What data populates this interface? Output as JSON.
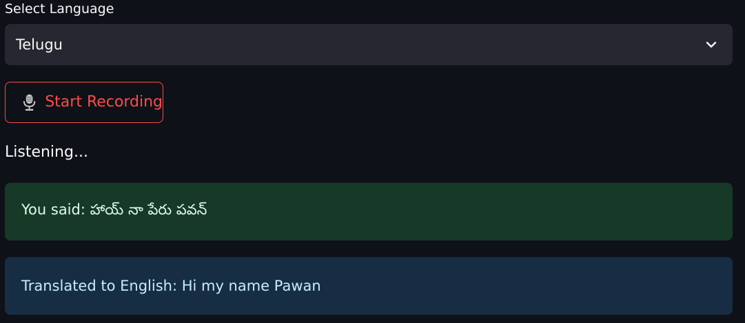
{
  "language_select": {
    "label": "Select Language",
    "selected_value": "Telugu"
  },
  "record_button": {
    "label": "Start Recording",
    "icon": "microphone-icon"
  },
  "status": {
    "text": "Listening..."
  },
  "transcription": {
    "text": "You said: హాయ్ నా పేరు పవన్"
  },
  "translation": {
    "text": "Translated to English: Hi my name Pawan"
  },
  "colors": {
    "background": "#0e1117",
    "select_background": "#262730",
    "accent_red": "#ff4b4b",
    "success_background": "#173928",
    "success_text": "#dffde9",
    "info_background": "#172d43",
    "info_text": "#c7ebff"
  }
}
